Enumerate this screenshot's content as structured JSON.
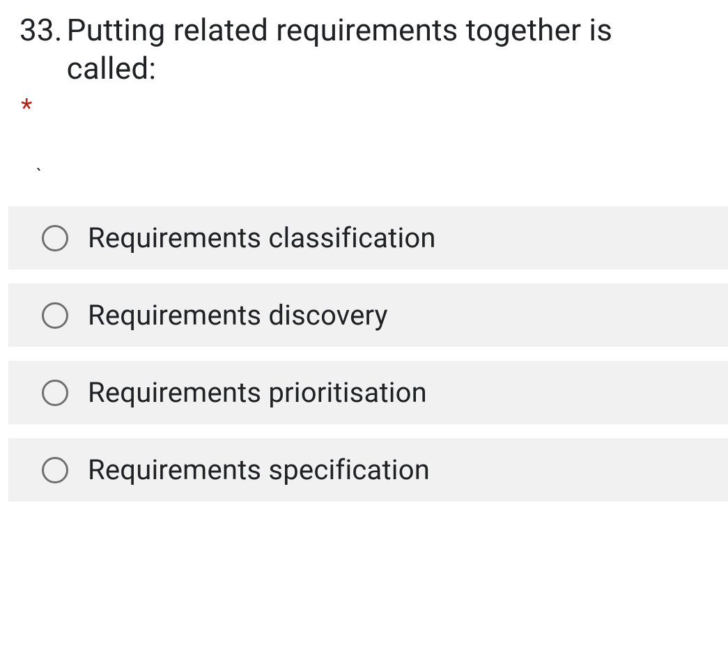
{
  "question": {
    "number": "33.",
    "text": "Putting related requirements together is called:",
    "required_marker": "*",
    "tick": "`"
  },
  "options": [
    {
      "label": "Requirements classification"
    },
    {
      "label": "Requirements discovery"
    },
    {
      "label": "Requirements prioritisation"
    },
    {
      "label": "Requirements specification"
    }
  ]
}
